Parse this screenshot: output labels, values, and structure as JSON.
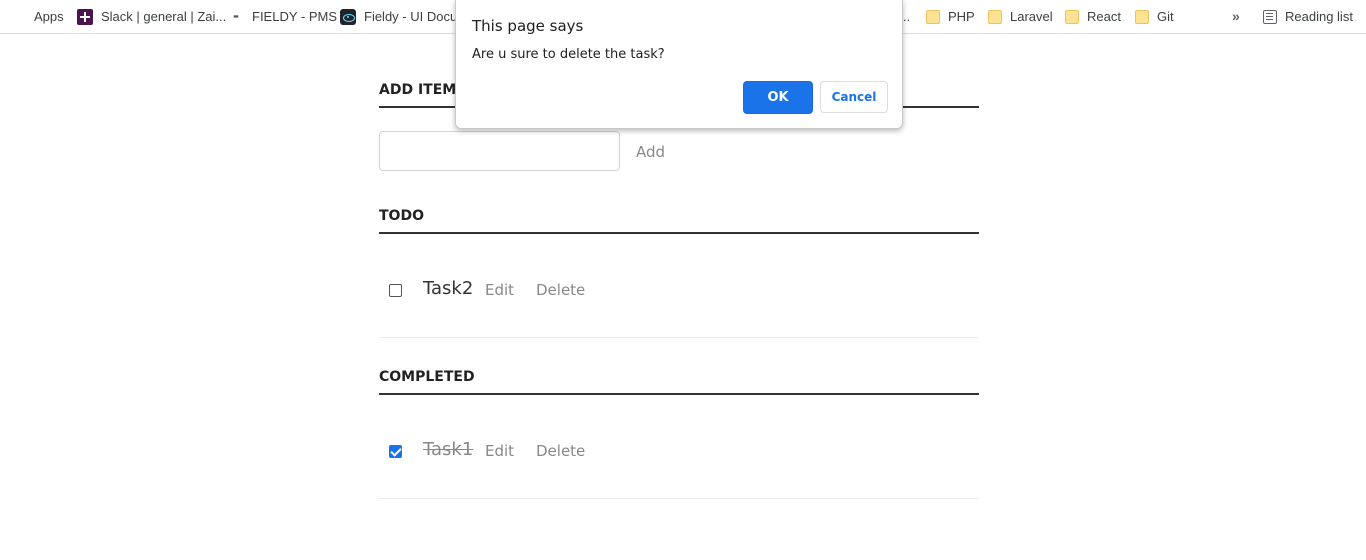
{
  "bookmarks_bar": {
    "items": [
      {
        "label": "Apps",
        "icon": "apps-grid-icon"
      },
      {
        "label": "Slack | general | Zai...",
        "icon": "slack-icon"
      },
      {
        "label": "FIELDY - PMS",
        "icon": "fieldy-logo-icon"
      },
      {
        "label": "Fieldy - UI Docum",
        "icon": "react-icon"
      },
      {
        "label": "..",
        "icon": ""
      },
      {
        "label": "PHP",
        "icon": "folder-icon"
      },
      {
        "label": "Laravel",
        "icon": "folder-icon"
      },
      {
        "label": "React",
        "icon": "folder-icon"
      },
      {
        "label": "Git",
        "icon": "folder-icon"
      }
    ],
    "overflow": "»",
    "reading_list": "Reading list"
  },
  "app": {
    "add_section": {
      "heading": "ADD ITEM",
      "input_value": "",
      "add_label": "Add"
    },
    "todo_section": {
      "heading": "TODO",
      "tasks": [
        {
          "name": "Task2",
          "checked": false,
          "edit": "Edit",
          "delete": "Delete"
        }
      ]
    },
    "completed_section": {
      "heading": "COMPLETED",
      "tasks": [
        {
          "name": "Task1",
          "checked": true,
          "edit": "Edit",
          "delete": "Delete"
        }
      ]
    }
  },
  "dialog": {
    "title": "This page says",
    "message": "Are u sure to delete the task?",
    "ok_label": "OK",
    "cancel_label": "Cancel"
  },
  "colors": {
    "accent": "#1a73e8",
    "heading_rule": "#333333",
    "muted_text": "#888888",
    "folder": "#fde293"
  }
}
